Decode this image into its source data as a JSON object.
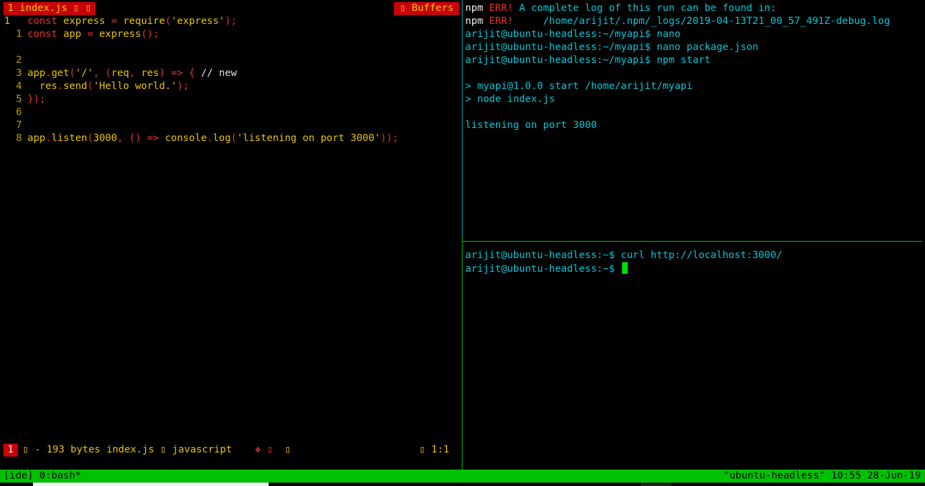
{
  "vim": {
    "tabline": {
      "active_tab_number": "1",
      "active_tab_name": "index.js",
      "tab_icons": "▯ ▯",
      "buffers_icon": "▯",
      "buffers_label": "Buffers"
    },
    "lines": [
      {
        "num": "1",
        "current": true,
        "tokens": [
          [
            "kw",
            "const "
          ],
          [
            "id",
            "express"
          ],
          [
            "kw",
            " = "
          ],
          [
            "id",
            "require"
          ],
          [
            "kw",
            "("
          ],
          [
            "str",
            "'express'"
          ],
          [
            "kw",
            ");"
          ]
        ]
      },
      {
        "num": "1",
        "current": false,
        "tokens": [
          [
            "kw",
            "const "
          ],
          [
            "id",
            "app"
          ],
          [
            "kw",
            " = "
          ],
          [
            "id",
            "express"
          ],
          [
            "kw",
            "();"
          ]
        ]
      },
      {
        "num": "",
        "current": false,
        "tokens": []
      },
      {
        "num": "2",
        "current": false,
        "tokens": []
      },
      {
        "num": "3",
        "current": false,
        "tokens": [
          [
            "id",
            "app"
          ],
          [
            "kw",
            "."
          ],
          [
            "id",
            "get"
          ],
          [
            "kw",
            "("
          ],
          [
            "str",
            "'/'"
          ],
          [
            "kw",
            ", ("
          ],
          [
            "id",
            "req"
          ],
          [
            "kw",
            ", "
          ],
          [
            "id",
            "res"
          ],
          [
            "kw",
            ") => { "
          ],
          [
            "plain",
            "// new"
          ]
        ]
      },
      {
        "num": "4",
        "current": false,
        "tokens": [
          [
            "plain",
            "  "
          ],
          [
            "id",
            "res"
          ],
          [
            "kw",
            "."
          ],
          [
            "id",
            "send"
          ],
          [
            "kw",
            "("
          ],
          [
            "str",
            "'Hello world.'"
          ],
          [
            "kw",
            ");"
          ]
        ]
      },
      {
        "num": "5",
        "current": false,
        "tokens": [
          [
            "kw",
            "});"
          ]
        ]
      },
      {
        "num": "6",
        "current": false,
        "tokens": []
      },
      {
        "num": "7",
        "current": false,
        "tokens": []
      },
      {
        "num": "8",
        "current": false,
        "tokens": [
          [
            "id",
            "app"
          ],
          [
            "kw",
            "."
          ],
          [
            "id",
            "listen"
          ],
          [
            "kw",
            "("
          ],
          [
            "num",
            "3000"
          ],
          [
            "kw",
            ", () => "
          ],
          [
            "id",
            "console"
          ],
          [
            "kw",
            "."
          ],
          [
            "id",
            "log"
          ],
          [
            "kw",
            "("
          ],
          [
            "str",
            "'listening on port 3000'"
          ],
          [
            "kw",
            "));"
          ]
        ]
      }
    ],
    "status": {
      "mode": "1",
      "mode_icon": "▯",
      "file_info": "- 193 bytes index.js ▯ javascript",
      "mark": "❖ ▯",
      "mark2": "▯",
      "position": "▯ 1:1"
    }
  },
  "terminal_top": {
    "lines": [
      {
        "parts": [
          [
            "t-white",
            "npm "
          ],
          [
            "t-err",
            "ERR!"
          ],
          [
            "t-cyan",
            " A complete log of this run can be found in:"
          ]
        ]
      },
      {
        "parts": [
          [
            "t-white",
            "npm "
          ],
          [
            "t-err",
            "ERR!"
          ],
          [
            "t-cyan",
            "     /home/arijit/.npm/_logs/2019-04-13T21_00_57_491Z-debug.log"
          ]
        ]
      },
      {
        "parts": [
          [
            "t-cyan",
            "arijit@ubuntu-headless:~/myapi$ nano"
          ]
        ]
      },
      {
        "parts": [
          [
            "t-cyan",
            "arijit@ubuntu-headless:~/myapi$ nano package.json"
          ]
        ]
      },
      {
        "parts": [
          [
            "t-cyan",
            "arijit@ubuntu-headless:~/myapi$ npm start"
          ]
        ]
      },
      {
        "parts": []
      },
      {
        "parts": [
          [
            "t-cyan",
            "> myapi@1.0.0 start /home/arijit/myapi"
          ]
        ]
      },
      {
        "parts": [
          [
            "t-cyan",
            "> node index.js"
          ]
        ]
      },
      {
        "parts": []
      },
      {
        "parts": [
          [
            "t-cyan",
            "listening on port 3000"
          ]
        ]
      }
    ]
  },
  "terminal_bottom": {
    "lines": [
      {
        "parts": [
          [
            "t-cyan",
            "arijit@ubuntu-headless:~$ curl http://localhost:3000/"
          ]
        ]
      },
      {
        "parts": [
          [
            "t-cyan",
            "arijit@ubuntu-headless:~$ "
          ]
        ],
        "cursor": true
      }
    ]
  },
  "tmux": {
    "left": "[ide] 0:bash*",
    "right": "\"ubuntu-headless\" 10:55 28-Jun-19"
  },
  "colors": {
    "tmux_green": "#00c000",
    "cursor_green": "#00e000",
    "accent_red": "#c8000a",
    "cyan_text": "#00c8d8",
    "code_yellow": "#e8c400"
  }
}
